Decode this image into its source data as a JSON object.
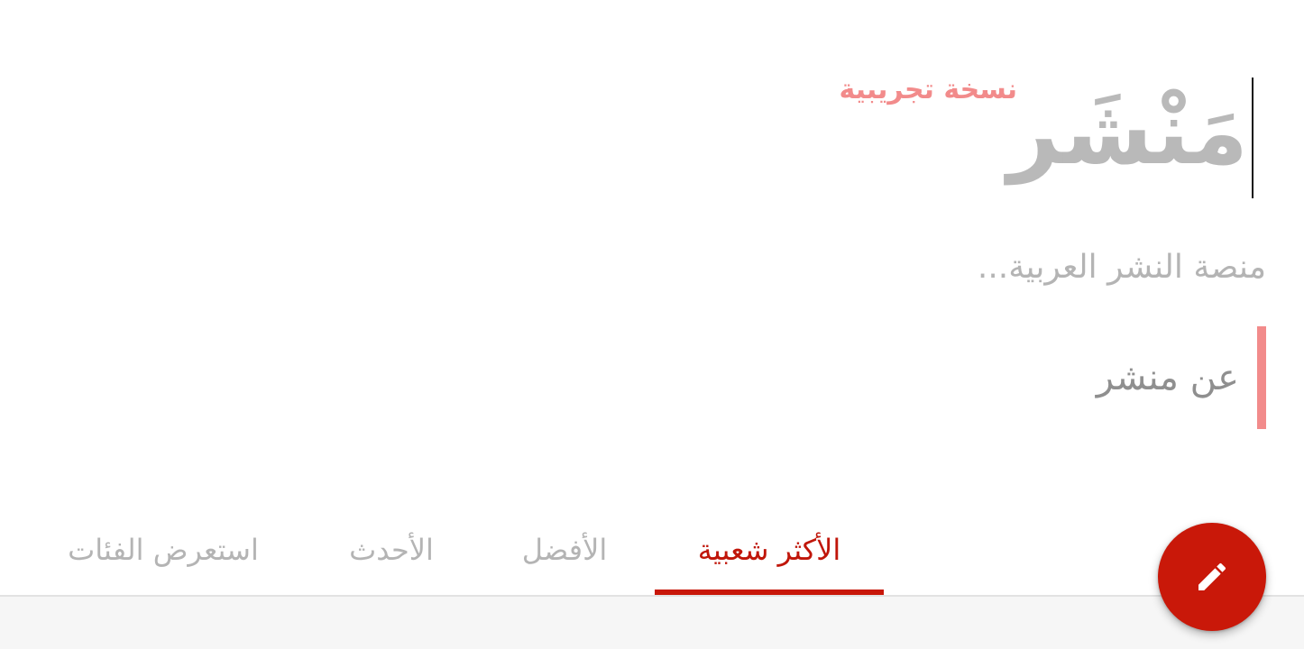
{
  "header": {
    "logo_title": "مَنْشَر",
    "logo_badge": "نسخة تجريبية"
  },
  "tagline": "منصة النشر العربية...",
  "about": {
    "label": "عن منشر"
  },
  "tabs": [
    {
      "label": "الأكثر شعبية",
      "active": true
    },
    {
      "label": "الأفضل",
      "active": false
    },
    {
      "label": "الأحدث",
      "active": false
    },
    {
      "label": "استعرض الفئات",
      "active": false
    }
  ],
  "fab": {
    "icon": "pencil-icon"
  },
  "colors": {
    "accent": "#c81709",
    "badge": "#f28b8b",
    "muted_text": "#b4b4b4"
  }
}
